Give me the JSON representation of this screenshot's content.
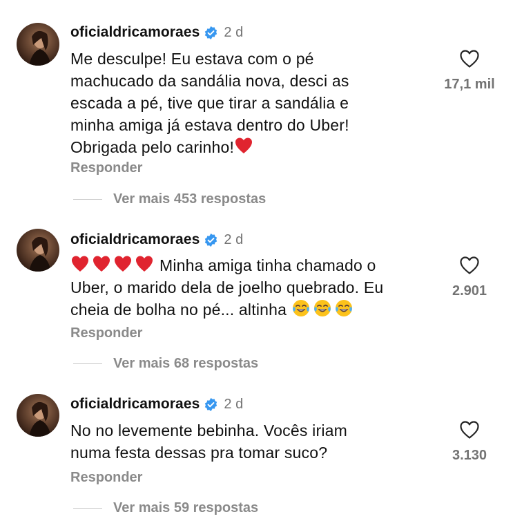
{
  "comments": [
    {
      "username": "oficialdricamoraes",
      "verified_icon": "verified-badge-icon",
      "time": "2 d",
      "lines": [
        "Me desculpe! Eu estava com o pé",
        "machucado da sandália nova, desci as",
        "escada a pé, tive que tirar a sandália e",
        "minha amiga já estava dentro do Uber!",
        "Obrigada pelo carinho!"
      ],
      "likes": "17,1 mil",
      "reply_label": "Responder",
      "view_replies_label": "Ver mais 453 respostas"
    },
    {
      "username": "oficialdricamoraes",
      "verified_icon": "verified-badge-icon",
      "time": "2 d",
      "lines": [
        "Minha amiga tinha chamado o",
        "Uber, o marido dela de joelho quebrado. Eu",
        "cheia de bolha no pé... altinha"
      ],
      "likes": "2.901",
      "reply_label": "Responder",
      "view_replies_label": "Ver mais 68 respostas"
    },
    {
      "username": "oficialdricamoraes",
      "verified_icon": "verified-badge-icon",
      "time": "2 d",
      "lines": [
        "No no levemente bebinha. Vocês iriam",
        "numa festa dessas pra tomar suco?"
      ],
      "likes": "3.130",
      "reply_label": "Responder",
      "view_replies_label": "Ver mais 59 respostas"
    }
  ],
  "colors": {
    "verified": "#3797f0",
    "heart_emoji": "#e0242f",
    "muted": "#8a8a8a"
  }
}
